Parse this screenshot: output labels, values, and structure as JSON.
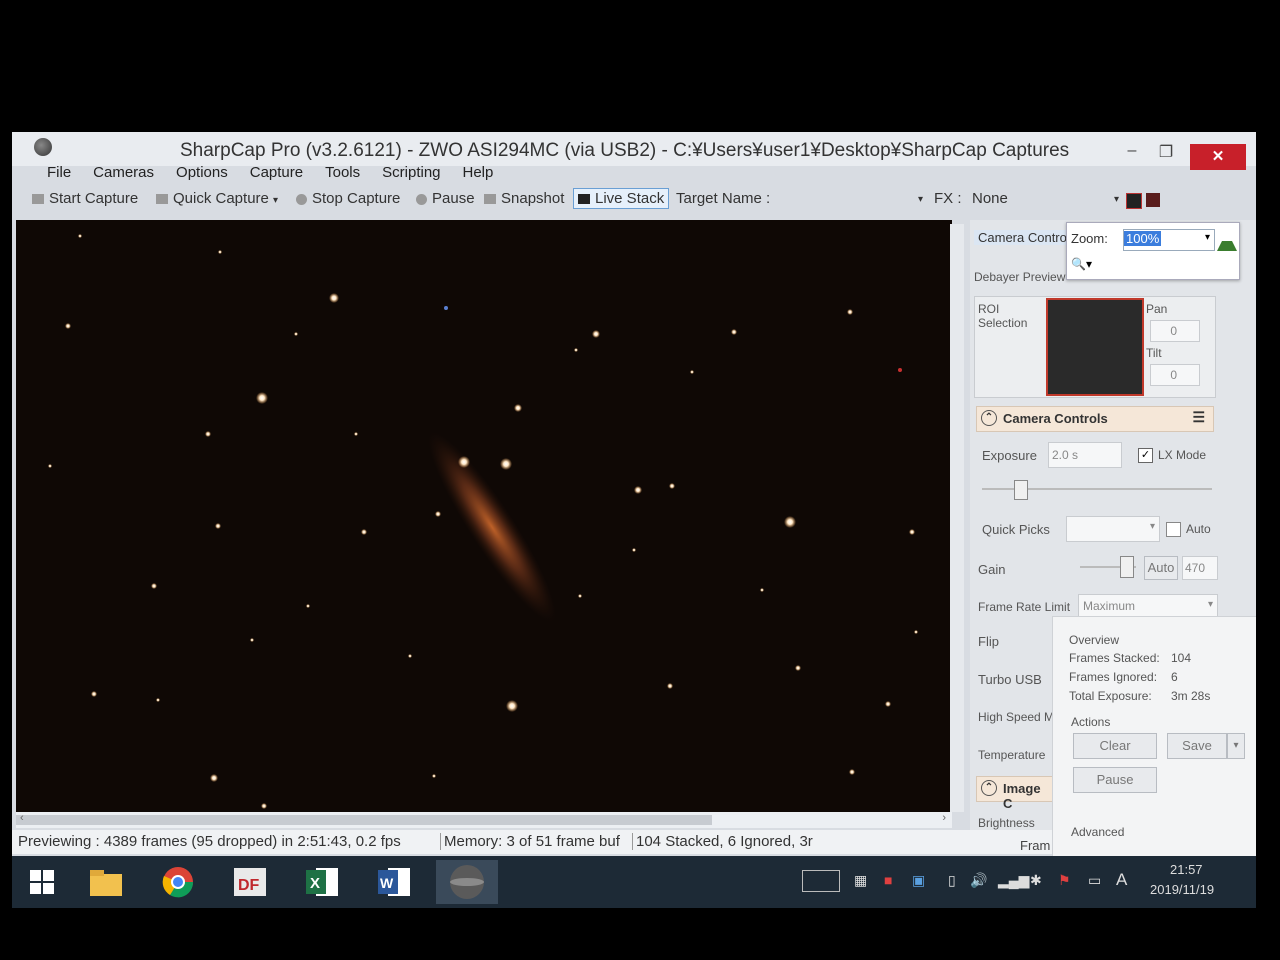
{
  "window": {
    "title": "SharpCap Pro (v3.2.6121) - ZWO ASI294MC (via USB2) - C:¥Users¥user1¥Desktop¥SharpCap Captures",
    "minimize": "–",
    "maximize": "❐",
    "close": "✕"
  },
  "menu": [
    "File",
    "Cameras",
    "Options",
    "Capture",
    "Tools",
    "Scripting",
    "Help"
  ],
  "toolbar": {
    "start_capture": "Start Capture",
    "quick_capture": "Quick Capture",
    "stop_capture": "Stop Capture",
    "pause": "Pause",
    "snapshot": "Snapshot",
    "live_stack": "Live Stack",
    "target_name_label": "Target Name :",
    "fx_label": "FX :",
    "fx_value": "None"
  },
  "zoom": {
    "label": "Zoom:",
    "value": "100%"
  },
  "panel": {
    "camera_control_tab": "Camera Contro",
    "debayer_preview": "Debayer Preview",
    "roi_label": "ROI Selection",
    "pan_label": "Pan",
    "pan_value": "0",
    "tilt_label": "Tilt",
    "tilt_value": "0",
    "camera_controls_header": "Camera Controls",
    "exposure_label": "Exposure",
    "exposure_value": "2.0 s",
    "lx_mode_label": "LX Mode",
    "quick_picks_label": "Quick Picks",
    "auto_label": "Auto",
    "gain_label": "Gain",
    "gain_auto": "Auto",
    "gain_value": "470",
    "frame_rate_label": "Frame Rate Limit",
    "frame_rate_value": "Maximum",
    "flip_label": "Flip",
    "turbo_usb_label": "Turbo USB",
    "high_speed_label": "High Speed M",
    "temperature_label": "Temperature",
    "image_controls_header": "Image C",
    "brightness_label": "Brightness",
    "frame_label": "Fram"
  },
  "live_stack": {
    "overview_label": "Overview",
    "frames_stacked_label": "Frames Stacked:",
    "frames_stacked_value": "104",
    "frames_ignored_label": "Frames Ignored:",
    "frames_ignored_value": "6",
    "total_exposure_label": "Total Exposure:",
    "total_exposure_value": "3m 28s",
    "actions_label": "Actions",
    "clear": "Clear",
    "save": "Save",
    "pause": "Pause",
    "advanced_label": "Advanced"
  },
  "status": {
    "previewing": "Previewing : 4389 frames (95 dropped) in 2:51:43, 0.2 fps",
    "memory": "Memory: 3 of 51 frame buf",
    "stacked": "104 Stacked, 6 Ignored, 3r"
  },
  "taskbar": {
    "time": "21:57",
    "date": "2019/11/19",
    "ime": "A",
    "apps": [
      "windows-start",
      "file-explorer",
      "chrome",
      "df-app",
      "excel",
      "word",
      "sharpcap"
    ]
  }
}
